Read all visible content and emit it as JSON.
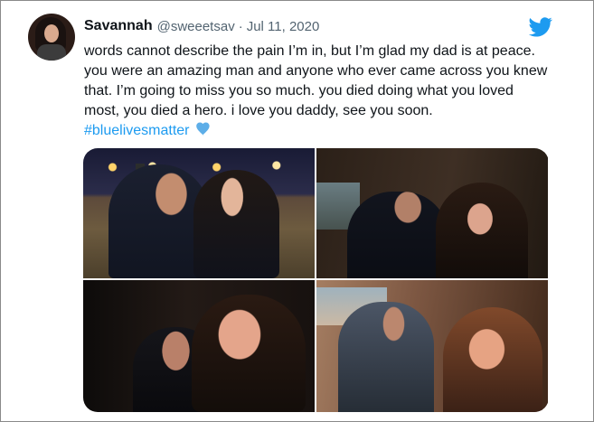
{
  "tweet": {
    "author_name": "Savannah",
    "author_handle": "@sweeetsav",
    "separator": "·",
    "date": "Jul 11, 2020",
    "text": "words cannot describe the pain I’m in, but I’m glad my dad is at peace. you were an amazing man and anyone who ever came across you knew that. I’m going to miss you so much. you died doing what you loved most, you died a hero. i love you daddy, see you soon.",
    "hashtag": "#bluelivesmatter",
    "heart_icon": "blue-heart-emoji",
    "logo_icon": "twitter-bird-icon"
  },
  "media": {
    "photo_count": 4
  },
  "colors": {
    "background": "#ffffff",
    "text": "#0f1419",
    "secondary_text": "#536471",
    "accent": "#1d9bf0",
    "heart": "#5daee8"
  }
}
